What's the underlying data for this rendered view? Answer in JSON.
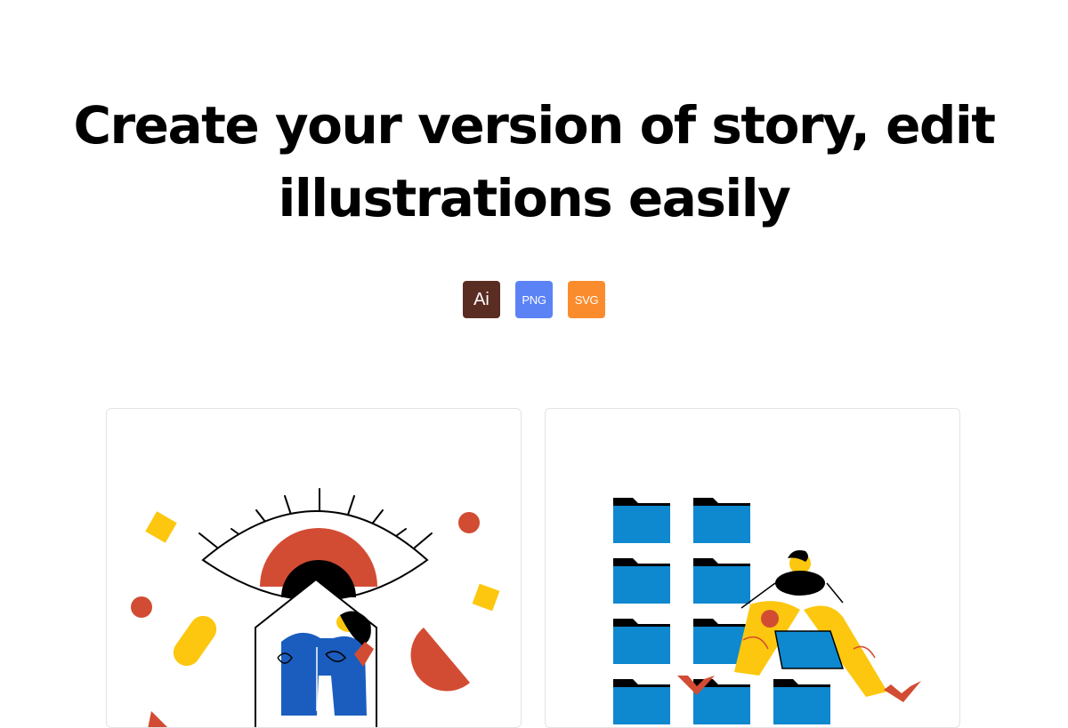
{
  "headline": {
    "line1": "Create your version of story, edit",
    "line2": "illustrations easily"
  },
  "formats": [
    {
      "label": "Ai",
      "color": "#5a2d22"
    },
    {
      "label": "PNG",
      "color": "#5b83f5"
    },
    {
      "label": "SVG",
      "color": "#fb8c2e"
    }
  ],
  "colors": {
    "red": "#d24c33",
    "yellow": "#fcc70e",
    "blue": "#1a5dbf",
    "folder_blue": "#0e88cf",
    "black": "#000000"
  },
  "cards": [
    {
      "illustration": "eye-house-illustration"
    },
    {
      "illustration": "folders-person-illustration"
    }
  ]
}
